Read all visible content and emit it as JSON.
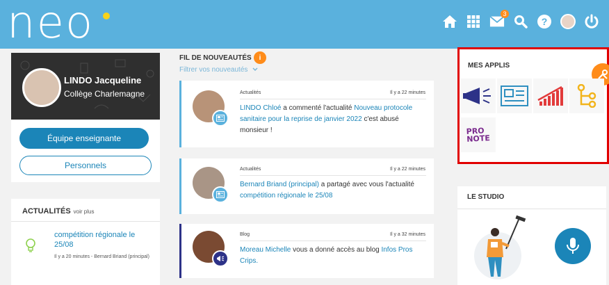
{
  "header": {
    "logo": "neo",
    "mail_badge": "3"
  },
  "profile": {
    "name": "LINDO Jacqueline",
    "school": "Collège Charlemagne",
    "team_button": "Équipe enseignante",
    "staff_button": "Personnels"
  },
  "news_widget": {
    "title": "ACTUALITÉS",
    "more": "voir plus",
    "item_title": "compétition régionale le 25/08",
    "item_meta": "Il y a 20 minutes - Bernard Briand (principal)"
  },
  "feed": {
    "title": "FIL DE NOUVEAUTÉS",
    "info": "i",
    "filter": "Filtrer vos nouveautés",
    "items": [
      {
        "category": "Actualités",
        "time": "Il y a 22 minutes",
        "author": "LINDO Chloé",
        "action": " a commenté l'actualité ",
        "target": "Nouveau protocole sanitaire pour la reprise de janvier 2022",
        "suffix": " c'est abusé monsieur !"
      },
      {
        "category": "Actualités",
        "time": "Il y a 22 minutes",
        "author": "Bernard Briand (principal)",
        "action": " a partagé avec vous l'actualité ",
        "target": "compétition régionale le 25/08",
        "suffix": ""
      },
      {
        "category": "Blog",
        "time": "Il y a 32 minutes",
        "author": "Moreau Michelle",
        "action": " vous a donné accès au blog ",
        "target": "Infos Pros Crips.",
        "suffix": ""
      }
    ]
  },
  "apps": {
    "title": "MES APPLIS",
    "tiles": [
      "megaphone-icon",
      "newspaper-icon",
      "chart-icon",
      "tree-icon"
    ],
    "pronote_line1": "PRO",
    "pronote_line2": "NOTE"
  },
  "studio": {
    "title": "LE STUDIO"
  }
}
